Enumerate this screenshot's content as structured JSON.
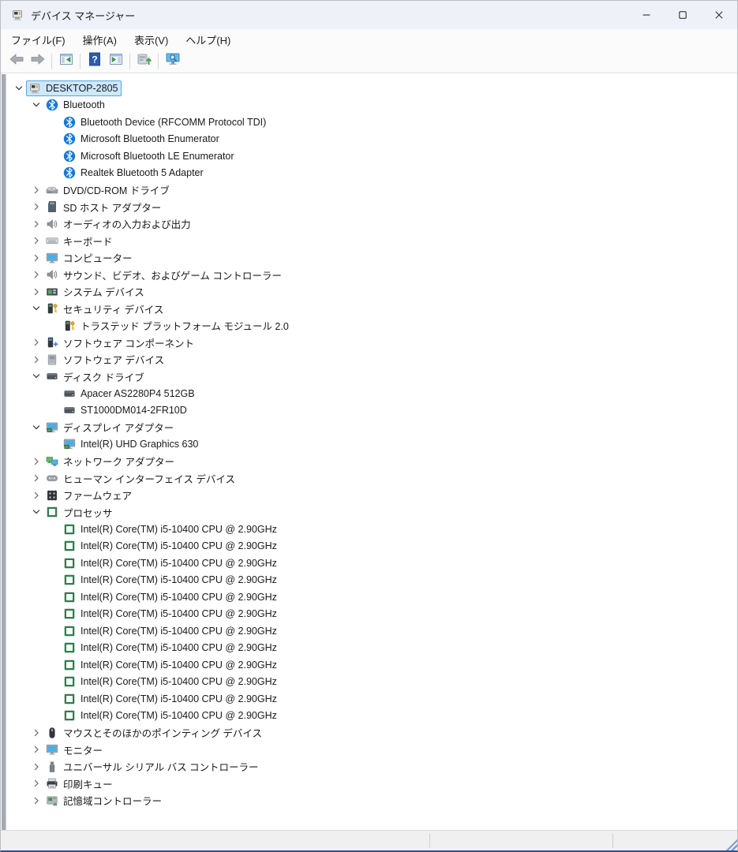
{
  "window": {
    "title": "デバイス マネージャー",
    "app_icon": "device-manager",
    "controls": [
      {
        "name": "minimize"
      },
      {
        "name": "maximize"
      },
      {
        "name": "close"
      }
    ]
  },
  "menu_bar": {
    "items": [
      {
        "label": "ファイル(F)"
      },
      {
        "label": "操作(A)"
      },
      {
        "label": "表示(V)"
      },
      {
        "label": "ヘルプ(H)"
      }
    ]
  },
  "toolbar": {
    "buttons": [
      {
        "type": "button",
        "name": "back",
        "icon": "arrow-left"
      },
      {
        "type": "button",
        "name": "forward",
        "icon": "arrow-right"
      },
      {
        "type": "separator"
      },
      {
        "type": "button",
        "name": "show-console-tree",
        "icon": "console-window"
      },
      {
        "type": "separator"
      },
      {
        "type": "button",
        "name": "help",
        "icon": "help"
      },
      {
        "type": "button",
        "name": "properties",
        "icon": "properties-window"
      },
      {
        "type": "separator"
      },
      {
        "type": "button",
        "name": "scan-hardware-changes",
        "icon": "scan-hardware"
      },
      {
        "type": "separator"
      },
      {
        "type": "button",
        "name": "device-search",
        "icon": "monitor-search"
      }
    ]
  },
  "tree": {
    "nodes": [
      {
        "level": 0,
        "state": "expanded",
        "icon": "pc",
        "label": "DESKTOP-2805",
        "selected": true
      },
      {
        "level": 1,
        "state": "expanded",
        "icon": "bluetooth",
        "label": "Bluetooth"
      },
      {
        "level": 2,
        "state": "leaf",
        "icon": "bluetooth",
        "label": "Bluetooth Device (RFCOMM Protocol TDI)"
      },
      {
        "level": 2,
        "state": "leaf",
        "icon": "bluetooth",
        "label": "Microsoft Bluetooth Enumerator"
      },
      {
        "level": 2,
        "state": "leaf",
        "icon": "bluetooth",
        "label": "Microsoft Bluetooth LE Enumerator"
      },
      {
        "level": 2,
        "state": "leaf",
        "icon": "bluetooth",
        "label": "Realtek Bluetooth 5 Adapter"
      },
      {
        "level": 1,
        "state": "collapsed",
        "icon": "dvd",
        "label": "DVD/CD-ROM ドライブ"
      },
      {
        "level": 1,
        "state": "collapsed",
        "icon": "sd-card",
        "label": "SD ホスト アダプター"
      },
      {
        "level": 1,
        "state": "collapsed",
        "icon": "audio",
        "label": "オーディオの入力および出力"
      },
      {
        "level": 1,
        "state": "collapsed",
        "icon": "keyboard",
        "label": "キーボード"
      },
      {
        "level": 1,
        "state": "collapsed",
        "icon": "monitor",
        "label": "コンピューター"
      },
      {
        "level": 1,
        "state": "collapsed",
        "icon": "audio",
        "label": "サウンド、ビデオ、およびゲーム コントローラー"
      },
      {
        "level": 1,
        "state": "collapsed",
        "icon": "system",
        "label": "システム デバイス"
      },
      {
        "level": 1,
        "state": "expanded",
        "icon": "security",
        "label": "セキュリティ デバイス"
      },
      {
        "level": 2,
        "state": "leaf",
        "icon": "security",
        "label": "トラステッド プラットフォーム モジュール 2.0"
      },
      {
        "level": 1,
        "state": "collapsed",
        "icon": "software-component",
        "label": "ソフトウェア コンポーネント"
      },
      {
        "level": 1,
        "state": "collapsed",
        "icon": "software-device",
        "label": "ソフトウェア デバイス"
      },
      {
        "level": 1,
        "state": "expanded",
        "icon": "disk",
        "label": "ディスク ドライブ"
      },
      {
        "level": 2,
        "state": "leaf",
        "icon": "disk",
        "label": "Apacer AS2280P4 512GB"
      },
      {
        "level": 2,
        "state": "leaf",
        "icon": "disk",
        "label": "ST1000DM014-2FR10D"
      },
      {
        "level": 1,
        "state": "expanded",
        "icon": "display",
        "label": "ディスプレイ アダプター"
      },
      {
        "level": 2,
        "state": "leaf",
        "icon": "display",
        "label": "Intel(R) UHD Graphics 630"
      },
      {
        "level": 1,
        "state": "collapsed",
        "icon": "network",
        "label": "ネットワーク アダプター"
      },
      {
        "level": 1,
        "state": "collapsed",
        "icon": "hid",
        "label": "ヒューマン インターフェイス デバイス"
      },
      {
        "level": 1,
        "state": "collapsed",
        "icon": "firmware",
        "label": "ファームウェア"
      },
      {
        "level": 1,
        "state": "expanded",
        "icon": "processor",
        "label": "プロセッサ"
      },
      {
        "level": 2,
        "state": "leaf",
        "icon": "processor",
        "label": "Intel(R) Core(TM) i5-10400 CPU @ 2.90GHz"
      },
      {
        "level": 2,
        "state": "leaf",
        "icon": "processor",
        "label": "Intel(R) Core(TM) i5-10400 CPU @ 2.90GHz"
      },
      {
        "level": 2,
        "state": "leaf",
        "icon": "processor",
        "label": "Intel(R) Core(TM) i5-10400 CPU @ 2.90GHz"
      },
      {
        "level": 2,
        "state": "leaf",
        "icon": "processor",
        "label": "Intel(R) Core(TM) i5-10400 CPU @ 2.90GHz"
      },
      {
        "level": 2,
        "state": "leaf",
        "icon": "processor",
        "label": "Intel(R) Core(TM) i5-10400 CPU @ 2.90GHz"
      },
      {
        "level": 2,
        "state": "leaf",
        "icon": "processor",
        "label": "Intel(R) Core(TM) i5-10400 CPU @ 2.90GHz"
      },
      {
        "level": 2,
        "state": "leaf",
        "icon": "processor",
        "label": "Intel(R) Core(TM) i5-10400 CPU @ 2.90GHz"
      },
      {
        "level": 2,
        "state": "leaf",
        "icon": "processor",
        "label": "Intel(R) Core(TM) i5-10400 CPU @ 2.90GHz"
      },
      {
        "level": 2,
        "state": "leaf",
        "icon": "processor",
        "label": "Intel(R) Core(TM) i5-10400 CPU @ 2.90GHz"
      },
      {
        "level": 2,
        "state": "leaf",
        "icon": "processor",
        "label": "Intel(R) Core(TM) i5-10400 CPU @ 2.90GHz"
      },
      {
        "level": 2,
        "state": "leaf",
        "icon": "processor",
        "label": "Intel(R) Core(TM) i5-10400 CPU @ 2.90GHz"
      },
      {
        "level": 2,
        "state": "leaf",
        "icon": "processor",
        "label": "Intel(R) Core(TM) i5-10400 CPU @ 2.90GHz"
      },
      {
        "level": 1,
        "state": "collapsed",
        "icon": "mouse",
        "label": "マウスとそのほかのポインティング デバイス"
      },
      {
        "level": 1,
        "state": "collapsed",
        "icon": "monitor",
        "label": "モニター"
      },
      {
        "level": 1,
        "state": "collapsed",
        "icon": "usb",
        "label": "ユニバーサル シリアル バス コントローラー"
      },
      {
        "level": 1,
        "state": "collapsed",
        "icon": "printer",
        "label": "印刷キュー"
      },
      {
        "level": 1,
        "state": "collapsed",
        "icon": "storage",
        "label": "記憶域コントローラー"
      }
    ]
  },
  "status_bar": {
    "segments": [
      "",
      "",
      ""
    ]
  },
  "colors": {
    "selection_bg": "#cce8ff",
    "selection_border": "#5aa3e0",
    "titlebar_bg": "#eef2f8",
    "window_bottom_border": "#2a519e",
    "bluetooth_blue": "#1379d8",
    "processor_green": "#2f7d4f"
  }
}
